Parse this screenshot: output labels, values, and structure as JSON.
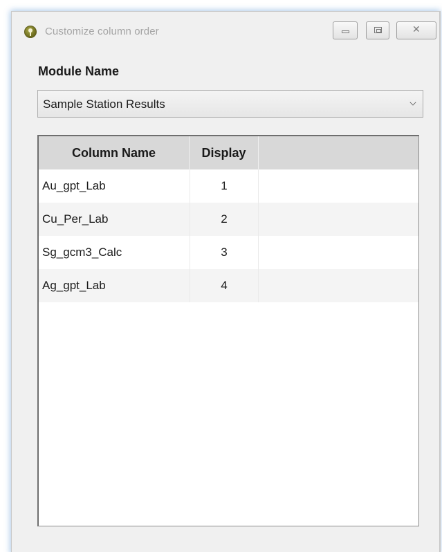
{
  "window": {
    "title": "Customize column order"
  },
  "icons": {
    "app": "app-info-icon",
    "minimize": "minimize-icon",
    "maximize": "maximize-icon",
    "close": "close-icon",
    "dropdown": "chevron-down-icon"
  },
  "form": {
    "module_label": "Module Name",
    "module_value": "Sample Station Results"
  },
  "grid": {
    "headers": [
      "Column Name",
      "Display"
    ],
    "rows": [
      {
        "name": "Au_gpt_Lab",
        "display": "1"
      },
      {
        "name": "Cu_Per_Lab",
        "display": "2"
      },
      {
        "name": "Sg_gcm3_Calc",
        "display": "3"
      },
      {
        "name": "Ag_gpt_Lab",
        "display": "4"
      }
    ]
  },
  "colors": {
    "window_bg": "#f0f0f0",
    "header_bg": "#d8d8d8",
    "alt_row_bg": "#f4f4f4",
    "title_text": "#a4a4a4",
    "app_icon": "#6b6a1c"
  }
}
